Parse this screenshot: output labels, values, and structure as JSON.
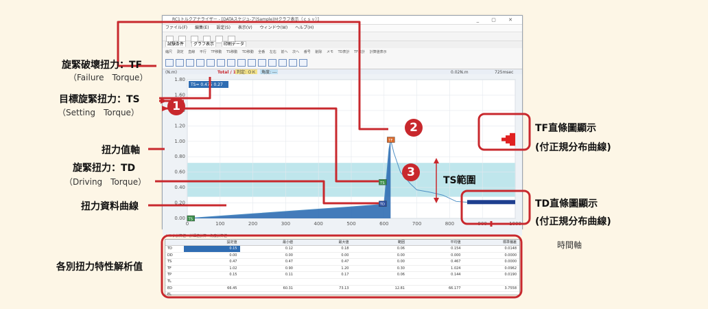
{
  "callouts": {
    "tf_title": "旋緊破壞扭力：TF",
    "tf_sub": "（Failure　Torque）",
    "ts_title": "目標旋緊扭力：TS",
    "ts_sub": "（Setting　Torque）",
    "axis_title": "扭力值軸",
    "td_title": "旋緊扭力：TD",
    "td_sub": "（Driving　Torque）",
    "curve_title": "扭力資料曲線",
    "analysis_title": "各別扭力特性解析值",
    "tf_hist_line1": "TF直條圖顯示",
    "tf_hist_line2": "(付正規分布曲線)",
    "ts_range": "TS範圍",
    "td_hist_line1": "TD直條圖顯示",
    "td_hist_line2": "(付正規分布曲線)",
    "time_axis": "時間軸",
    "num1": "1",
    "num2": "2",
    "num3": "3"
  },
  "window": {
    "title": "RC1トルクアナライザー - [DATAスケジュ-ア(Sample)Ｍクラフ表示（ｃｓｖ）]",
    "menus": [
      "ファイル(F)",
      "編集(E)",
      "設定(S)",
      "表示(V)",
      "ウィンドウ(W)",
      "ヘルプ(H)"
    ],
    "tabs": [
      "試験条件",
      "グラフ表示",
      "印刷データ"
    ],
    "toolbar_labels": [
      "縮尺",
      "測定",
      "直線",
      "平行",
      "TF移動",
      "TS移動",
      "TD移動",
      "全番",
      "左右",
      "前へ",
      "次へ",
      "番号",
      "削除",
      "メモ",
      "TD表計",
      "TF表計",
      "計算値表示"
    ],
    "status_unit": "(N.m)",
    "status_total": "Total / 10",
    "status_tag1": "判定: ＯＫ",
    "status_tag2": "角度: ---",
    "status_right1": "0.02N.m",
    "status_right2": "725msec",
    "ts_box": "TS= 0.475  0.27"
  },
  "chart_data": {
    "type": "line",
    "ylim": [
      0,
      1.8
    ],
    "xlim": [
      0,
      1000
    ],
    "yticks": [
      "1.80",
      "1.60",
      "1.40",
      "1.20",
      "1.00",
      "0.80",
      "0.60",
      "0.40",
      "0.20",
      "0.00"
    ],
    "xticks": [
      "0",
      "100",
      "200",
      "300",
      "400",
      "500",
      "600",
      "700",
      "800",
      "900",
      "1000"
    ],
    "ts_band": [
      0.28,
      0.72
    ],
    "markers": {
      "TF": [
        620,
        1.02
      ],
      "TS": [
        595,
        0.47
      ],
      "TD": [
        595,
        0.19
      ],
      "TS0": [
        10,
        0.0
      ]
    },
    "curve": [
      [
        0,
        0.0
      ],
      [
        100,
        0.03
      ],
      [
        200,
        0.06
      ],
      [
        300,
        0.09
      ],
      [
        400,
        0.12
      ],
      [
        500,
        0.15
      ],
      [
        590,
        0.18
      ],
      [
        600,
        0.19
      ],
      [
        615,
        0.9
      ],
      [
        620,
        1.02
      ],
      [
        630,
        0.85
      ],
      [
        650,
        0.6
      ],
      [
        680,
        0.45
      ],
      [
        700,
        0.37
      ],
      [
        740,
        0.34
      ],
      [
        780,
        0.3
      ],
      [
        820,
        0.22
      ],
      [
        850,
        0.21
      ],
      [
        900,
        0.22
      ],
      [
        950,
        0.21
      ],
      [
        1000,
        0.21
      ]
    ]
  },
  "table": {
    "tab_title": "トルク計算値　詳細値計算　角度計算値",
    "headers": [
      "",
      "設定値",
      "最小値",
      "最大値",
      "範囲",
      "平均値",
      "標準偏差"
    ],
    "rows": [
      [
        "TD",
        "0.15",
        "0.12",
        "0.18",
        "0.06",
        "0.154",
        "0.0148"
      ],
      [
        "DD",
        "0.00",
        "0.00",
        "0.00",
        "0.00",
        "0.000",
        "0.0000"
      ],
      [
        "TS",
        "0.47",
        "0.47",
        "0.47",
        "0.00",
        "0.467",
        "0.0000"
      ],
      [
        "TF",
        "1.02",
        "0.90",
        "1.20",
        "0.30",
        "1.024",
        "0.0962"
      ],
      [
        "TP",
        "0.15",
        "0.11",
        "0.17",
        "0.06",
        "0.144",
        "0.0190"
      ],
      [
        "TL",
        "",
        "",
        "",
        "",
        "",
        ""
      ],
      [
        "ED",
        "66.45",
        "60.31",
        "73.13",
        "12.81",
        "66.177",
        "3.7558"
      ],
      [
        "EL",
        "",
        "",
        "",
        "",
        "",
        ""
      ]
    ]
  },
  "colors": {
    "accent": "#c8282d",
    "band": "#bfe6ec",
    "curve_fill": "#2f6db3",
    "curve_line": "#4e8fc4",
    "tf_hist": "#e02020",
    "td_hist": "#1e3f8f"
  }
}
